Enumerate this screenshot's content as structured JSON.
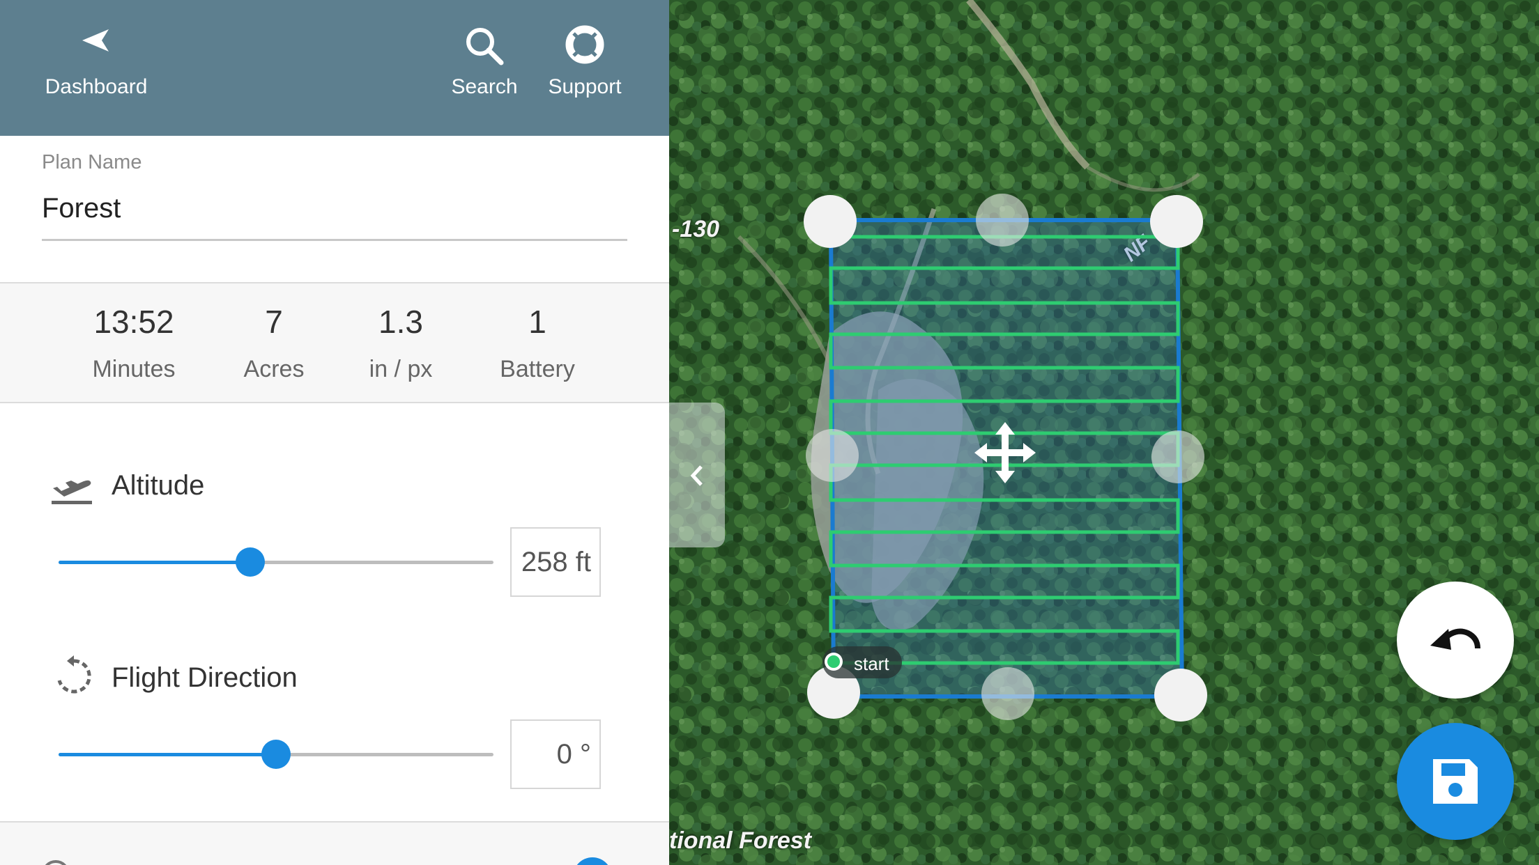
{
  "header": {
    "dashboard_label": "Dashboard",
    "search_label": "Search",
    "support_label": "Support"
  },
  "plan": {
    "name_label": "Plan Name",
    "name_value": "Forest"
  },
  "stats": [
    {
      "value": "13:52",
      "unit": "Minutes"
    },
    {
      "value": "7",
      "unit": "Acres"
    },
    {
      "value": "1.3",
      "unit": "in / px"
    },
    {
      "value": "1",
      "unit": "Battery"
    }
  ],
  "settings": {
    "altitude": {
      "label": "Altitude",
      "value": "258 ft",
      "slider_fraction": 0.44
    },
    "flight_direction": {
      "label": "Flight Direction",
      "value": "0 °",
      "slider_fraction": 0.5
    }
  },
  "map": {
    "road_label": "-130",
    "road_label_2": "NF",
    "forest_label": "tional Forest",
    "start_label": "start"
  },
  "colors": {
    "header_bg": "#5d7f8f",
    "accent": "#1a8be0",
    "flight_path": "#2ecc71",
    "boundary": "#1a7bd0"
  },
  "icons": {
    "back": "back-arrow-icon",
    "search": "search-icon",
    "support": "lifebuoy-icon",
    "altitude": "takeoff-icon",
    "direction": "rotate-icon",
    "undo": "undo-icon",
    "save": "save-icon",
    "move": "move-icon"
  }
}
